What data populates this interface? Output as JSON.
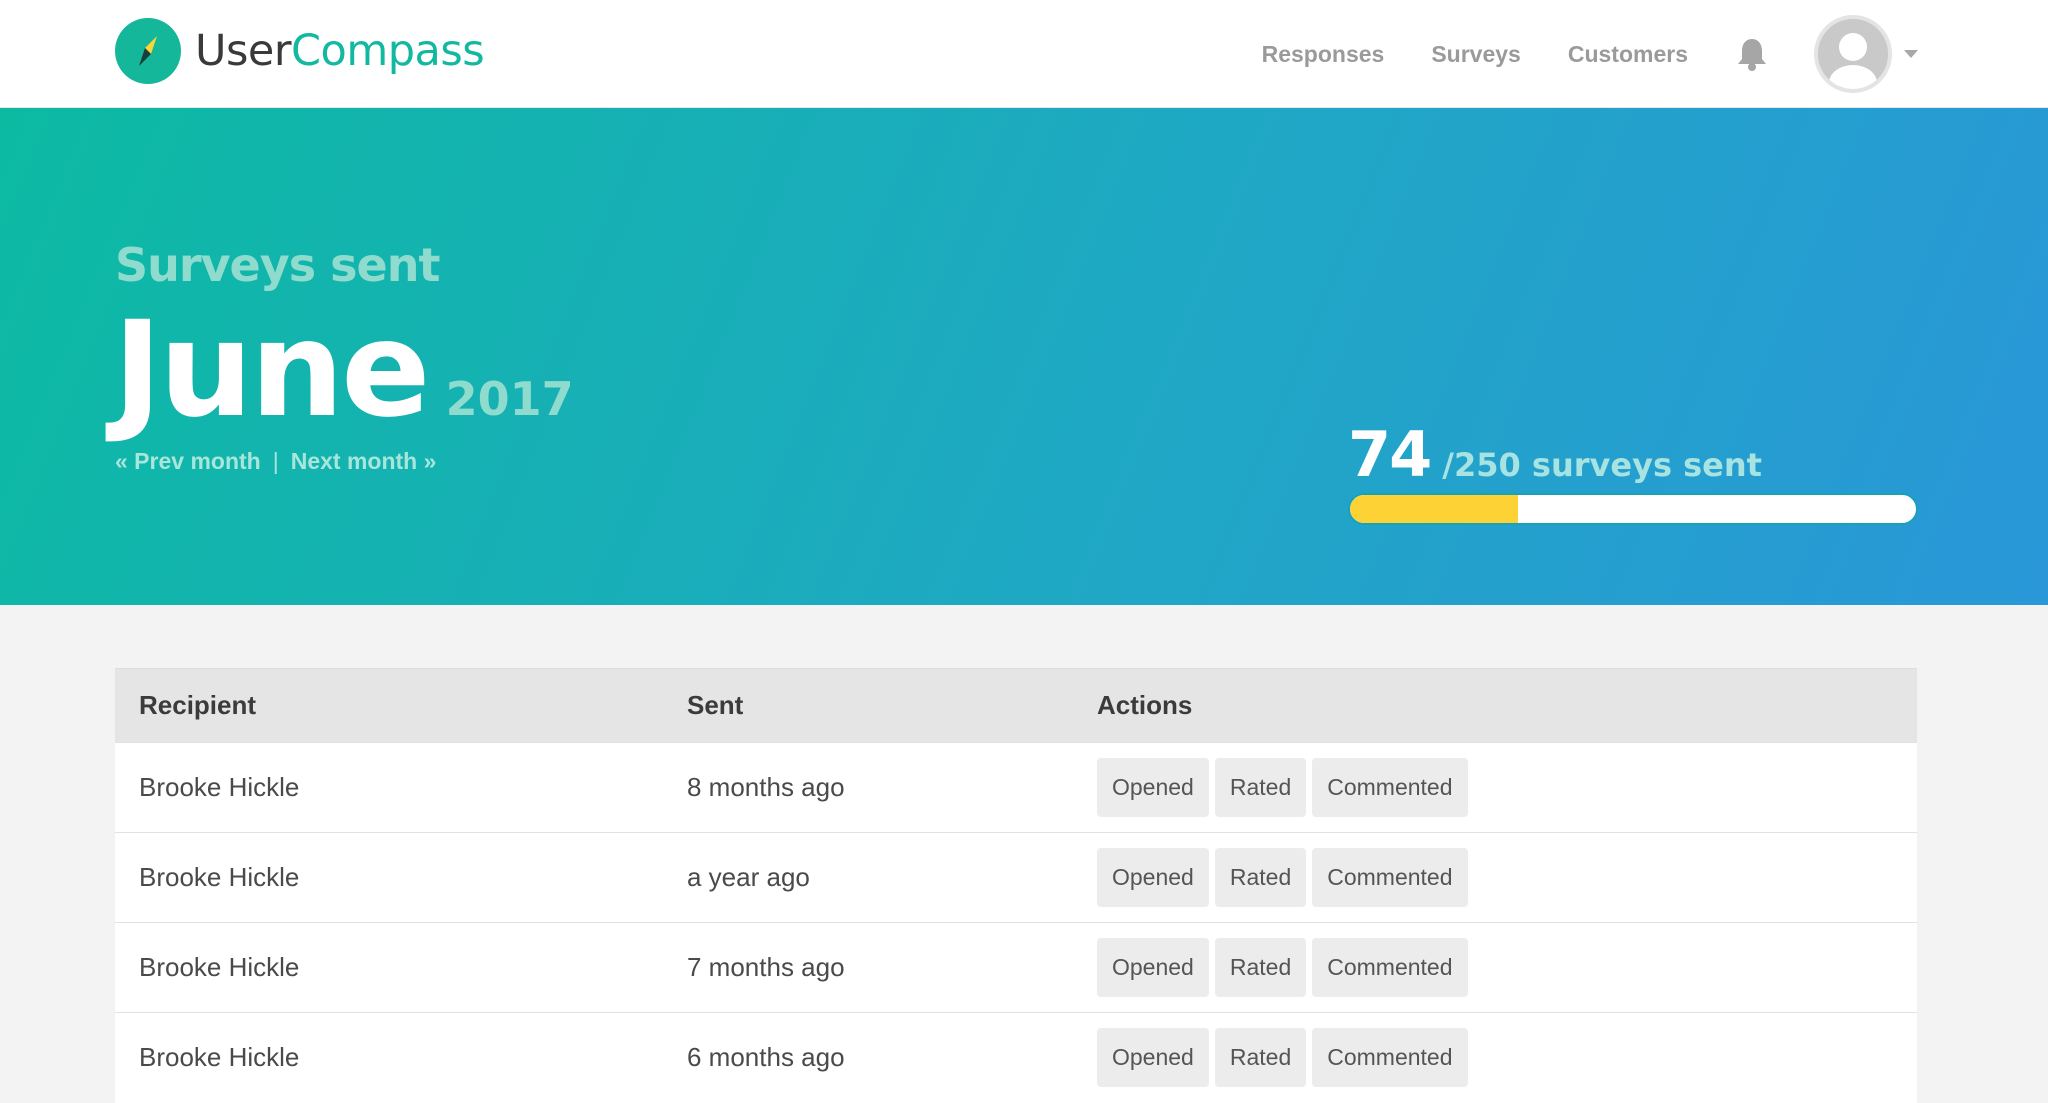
{
  "brand": {
    "name_part1": "User",
    "name_part2": "Compass"
  },
  "nav": {
    "links": [
      "Responses",
      "Surveys",
      "Customers"
    ],
    "icons": {
      "notifications": "bell-icon",
      "menu": "caret-down-icon"
    }
  },
  "hero": {
    "subtitle": "Surveys sent",
    "month": "June",
    "year": "2017",
    "prev_label": "« Prev month",
    "separator": "|",
    "next_label": "Next month »"
  },
  "quota": {
    "sent": "74",
    "total_label": "/250 surveys sent",
    "progress_fraction": 0.296,
    "fill_color": "#fdd235"
  },
  "table": {
    "headers": [
      "Recipient",
      "Sent",
      "Actions"
    ],
    "rows": [
      {
        "recipient": "Brooke Hickle",
        "sent": "8 months ago",
        "actions": [
          "Opened",
          "Rated",
          "Commented"
        ]
      },
      {
        "recipient": "Brooke Hickle",
        "sent": "a year ago",
        "actions": [
          "Opened",
          "Rated",
          "Commented"
        ]
      },
      {
        "recipient": "Brooke Hickle",
        "sent": "7 months ago",
        "actions": [
          "Opened",
          "Rated",
          "Commented"
        ]
      },
      {
        "recipient": "Brooke Hickle",
        "sent": "6 months ago",
        "actions": [
          "Opened",
          "Rated",
          "Commented"
        ]
      }
    ]
  },
  "colors": {
    "brand_accent": "#13b8a0",
    "hero_gradient_start": "#0cbaa2",
    "hero_gradient_end": "#2997d8"
  }
}
